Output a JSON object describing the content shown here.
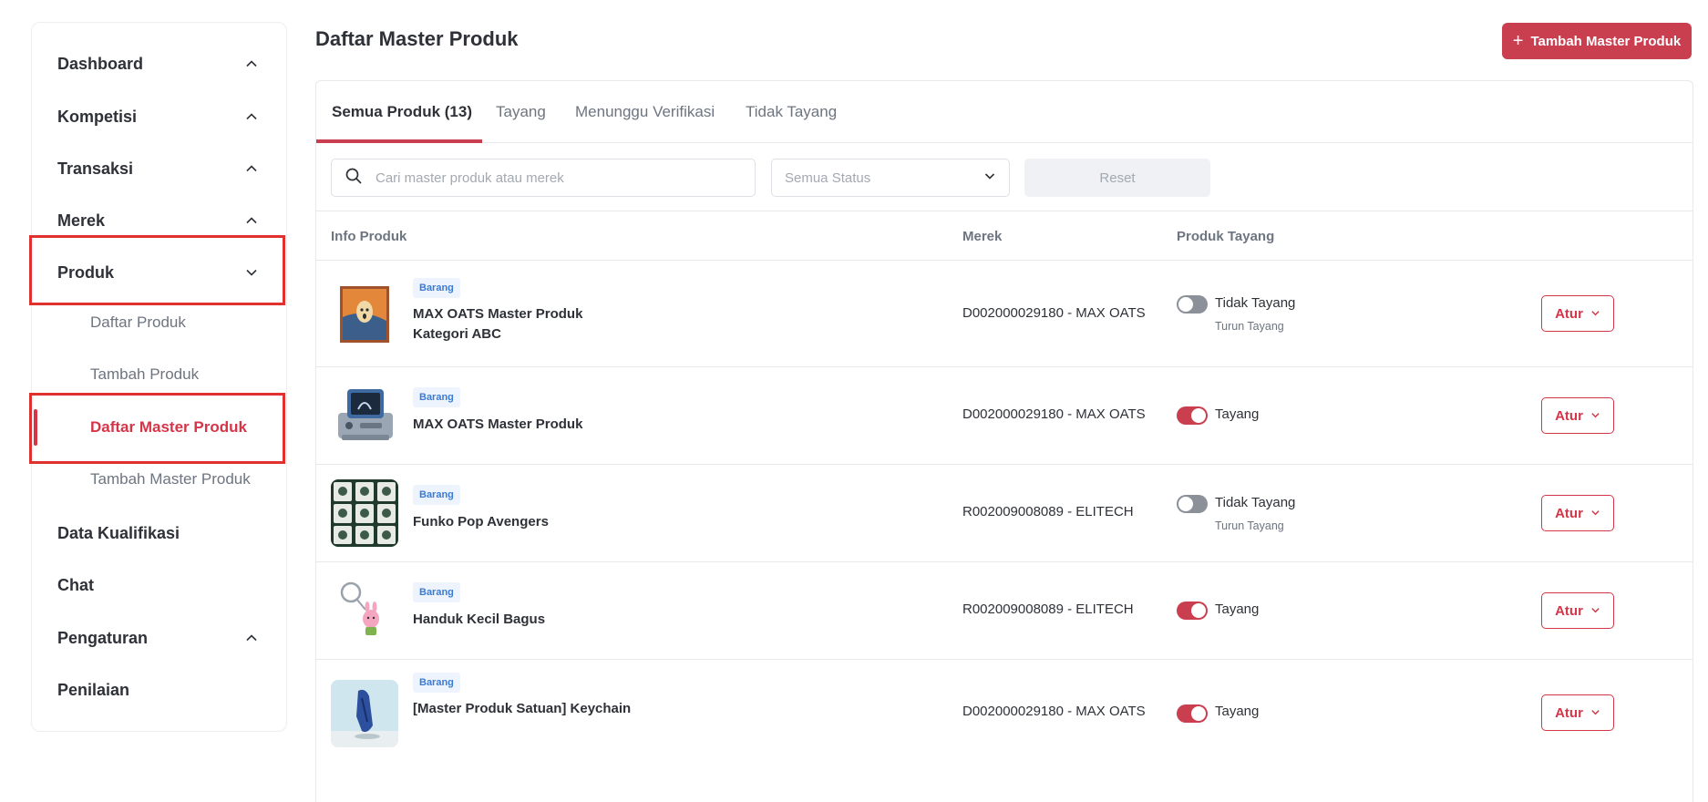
{
  "sidebar": {
    "items": [
      {
        "label": "Dashboard"
      },
      {
        "label": "Kompetisi"
      },
      {
        "label": "Transaksi"
      },
      {
        "label": "Merek"
      },
      {
        "label": "Produk"
      },
      {
        "label": "Data Kualifikasi"
      },
      {
        "label": "Chat"
      },
      {
        "label": "Pengaturan"
      },
      {
        "label": "Penilaian"
      }
    ],
    "produk_sub": [
      {
        "label": "Daftar Produk"
      },
      {
        "label": "Tambah Produk"
      },
      {
        "label": "Daftar Master Produk",
        "active": true
      },
      {
        "label": "Tambah Master Produk"
      }
    ]
  },
  "header": {
    "title": "Daftar Master Produk",
    "add_label": "Tambah Master Produk"
  },
  "tabs": [
    {
      "label": "Semua Produk (13)",
      "active": true
    },
    {
      "label": "Tayang"
    },
    {
      "label": "Menunggu Verifikasi"
    },
    {
      "label": "Tidak Tayang"
    }
  ],
  "filters": {
    "search_placeholder": "Cari master produk atau merek",
    "status_value": "Semua Status",
    "reset_label": "Reset"
  },
  "table": {
    "columns": [
      "Info Produk",
      "Merek",
      "Produk Tayang"
    ],
    "rows": [
      {
        "badge": "Barang",
        "name": "MAX OATS Master Produk Kategori ABC",
        "merek": "D002000029180 - MAX OATS",
        "status": "Tidak Tayang",
        "status_sub": "Turun Tayang",
        "tayang": false,
        "action": "Atur"
      },
      {
        "badge": "Barang",
        "name": "MAX OATS Master Produk",
        "merek": "D002000029180 - MAX OATS",
        "status": "Tayang",
        "status_sub": "",
        "tayang": true,
        "action": "Atur"
      },
      {
        "badge": "Barang",
        "name": "Funko Pop Avengers",
        "merek": "R002009008089 - ELITECH",
        "status": "Tidak Tayang",
        "status_sub": "Turun Tayang",
        "tayang": false,
        "action": "Atur"
      },
      {
        "badge": "Barang",
        "name": "Handuk Kecil Bagus",
        "merek": "R002009008089 - ELITECH",
        "status": "Tayang",
        "status_sub": "",
        "tayang": true,
        "action": "Atur"
      },
      {
        "badge": "Barang",
        "name": "[Master Produk Satuan] Keychain",
        "merek": "D002000029180 - MAX OATS",
        "status": "Tayang",
        "status_sub": "",
        "tayang": true,
        "action": "Atur"
      }
    ]
  },
  "colors": {
    "accent": "#c93f50",
    "highlight": "#e0312f",
    "badge_text": "#3a7bd5"
  }
}
